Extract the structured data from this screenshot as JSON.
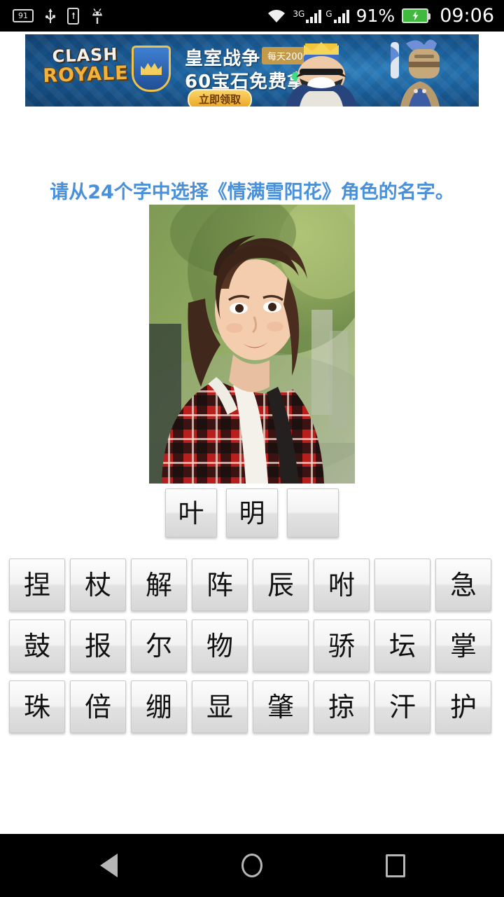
{
  "status_bar": {
    "battery_number_icon": "battery-number-icon",
    "battery_number_label": "91",
    "usb_icon": "usb-icon",
    "sdcard_icon": "sdcard-icon",
    "android_icon": "android-icon",
    "wifi_icon": "wifi-icon",
    "network_1_label": "3G",
    "network_2_label": "G",
    "battery_percent": "91%",
    "battery_icon": "battery-charging-icon",
    "time": "09:06"
  },
  "ad_banner": {
    "logo_line1": "CLASH",
    "logo_line2": "ROYALE",
    "headline_1": "皇室战争",
    "badge": "每天20000份",
    "headline_2": "60宝石免费拿",
    "cta_label": "立即领取",
    "shield_icon": "crown-shield-icon",
    "gem_icon": "gem-icon",
    "character_king": "king-character-icon",
    "character_knight": "knight-character-icon"
  },
  "main": {
    "question": "请从24个字中选择《情满雪阳花》角色的名字。",
    "question_color": "#4a90d9",
    "photo_alt": "woman-in-red-plaid-shirt-photo",
    "answer_slots": [
      "叶",
      "明",
      ""
    ],
    "character_grid": [
      [
        "捏",
        "杖",
        "解",
        "阵",
        "辰",
        "咐",
        "",
        "急"
      ],
      [
        "鼓",
        "报",
        "尔",
        "物",
        "",
        "骄",
        "坛",
        "掌"
      ],
      [
        "珠",
        "倍",
        "绷",
        "显",
        "肇",
        "掠",
        "汗",
        "护"
      ]
    ]
  },
  "nav_bar": {
    "back_icon": "back-triangle-icon",
    "home_icon": "home-circle-icon",
    "recents_icon": "recents-square-icon"
  }
}
